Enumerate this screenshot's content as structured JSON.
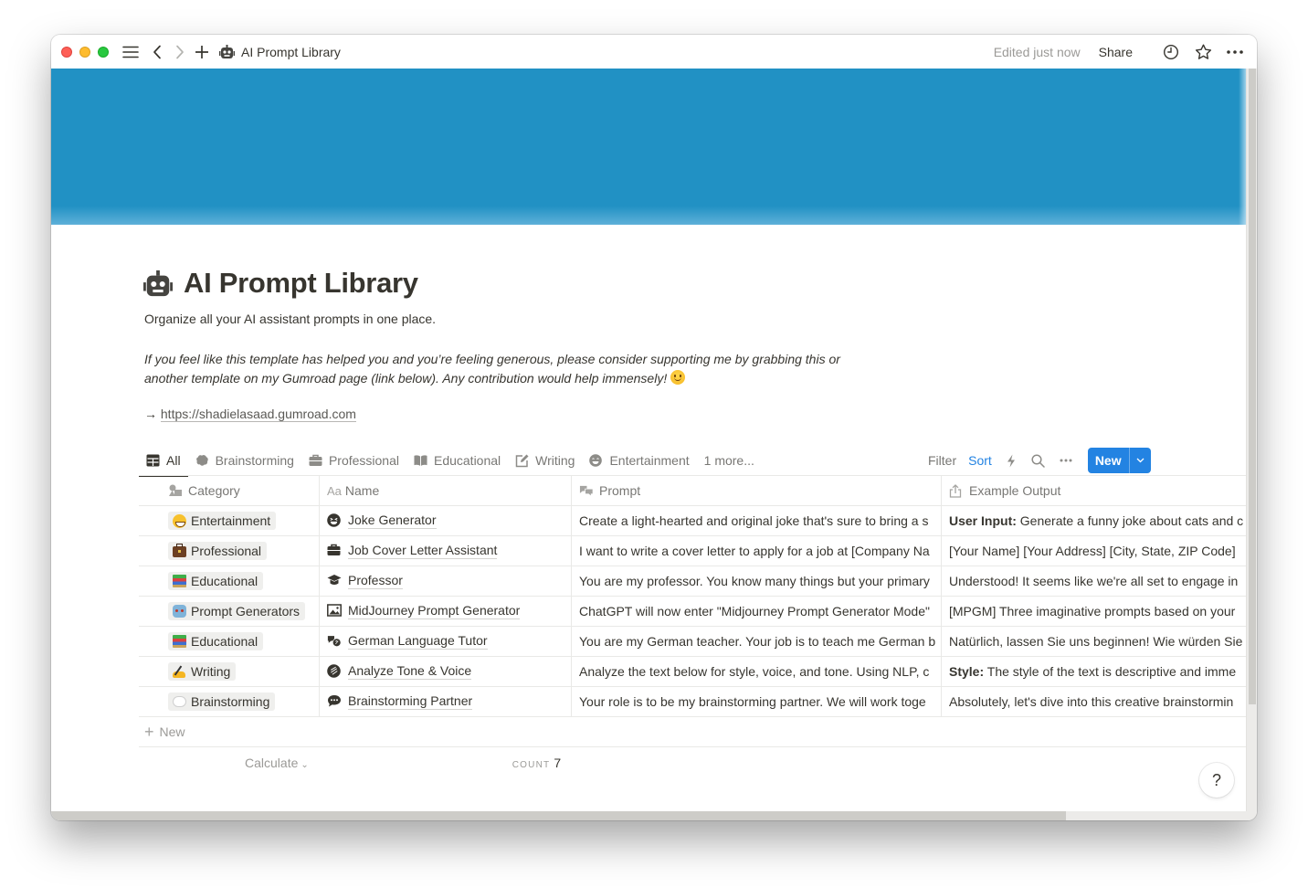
{
  "window": {
    "title": "AI Prompt Library",
    "edited_status": "Edited just now",
    "share_label": "Share"
  },
  "page": {
    "title": "AI Prompt Library",
    "description": "Organize all your AI assistant prompts in one place.",
    "support_text": "If you feel like this template has helped you and you’re feeling generous, please consider supporting me by grabbing this or another template on my Gumroad page (link below). Any contribution would help immensely!",
    "link_arrow": "→",
    "link_text": "https://shadielasaad.gumroad.com",
    "cover_color": "#2191c4"
  },
  "views": {
    "tabs": [
      {
        "label": "All",
        "icon": "table-icon",
        "active": true
      },
      {
        "label": "Brainstorming",
        "icon": "brain-icon",
        "active": false
      },
      {
        "label": "Professional",
        "icon": "briefcase-icon",
        "active": false
      },
      {
        "label": "Educational",
        "icon": "book-icon",
        "active": false
      },
      {
        "label": "Writing",
        "icon": "edit-icon",
        "active": false
      },
      {
        "label": "Entertainment",
        "icon": "grin-icon",
        "active": false
      }
    ],
    "more_label": "1 more...",
    "filter_label": "Filter",
    "sort_label": "Sort",
    "new_label": "New",
    "accent_color": "#2383e2"
  },
  "table": {
    "columns": [
      {
        "label": "Category",
        "icon": "multi-select-icon"
      },
      {
        "label": "Name",
        "icon": "text-title-icon",
        "icon_text": "Aa"
      },
      {
        "label": "Prompt",
        "icon": "comments-icon"
      },
      {
        "label": "Example Output",
        "icon": "share-icon"
      }
    ],
    "rows": [
      {
        "category": "Entertainment",
        "category_emoji": "grinning-face",
        "name": "Joke Generator",
        "name_icon": "grin-squint-icon",
        "prompt": "Create a light-hearted and original joke that's sure to bring a s",
        "output_bold": "User Input:",
        "output": " Generate a funny joke about cats and c"
      },
      {
        "category": "Professional",
        "category_emoji": "briefcase",
        "name": "Job Cover Letter Assistant",
        "name_icon": "briefcase-icon",
        "prompt": "I want to write a cover letter to apply for a job at [Company Na",
        "output_bold": "",
        "output": "[Your Name] [Your Address] [City, State, ZIP Code]"
      },
      {
        "category": "Educational",
        "category_emoji": "books",
        "name": "Professor",
        "name_icon": "graduation-cap-icon",
        "prompt": "You are my professor. You know many things but your primary",
        "output_bold": "",
        "output": "Understood! It seems like we're all set to engage in"
      },
      {
        "category": "Prompt Generators",
        "category_emoji": "robot",
        "name": "MidJourney Prompt Generator",
        "name_icon": "image-icon",
        "prompt": "ChatGPT will now enter \"Midjourney Prompt Generator Mode\"",
        "output_bold": "",
        "output": "[MPGM] Three imaginative prompts based on your"
      },
      {
        "category": "Educational",
        "category_emoji": "books",
        "name": "German Language Tutor",
        "name_icon": "language-icon",
        "prompt": "You are my German teacher. Your job is to teach me German b",
        "output_bold": "",
        "output": "Natürlich, lassen Sie uns beginnen! Wie würden Sie"
      },
      {
        "category": "Writing",
        "category_emoji": "writing-hand",
        "name": "Analyze Tone & Voice",
        "name_icon": "palette-icon",
        "prompt": "Analyze the text below for style, voice, and tone. Using NLP, c",
        "output_bold": "Style:",
        "output": " The style of the text is descriptive and imme"
      },
      {
        "category": "Brainstorming",
        "category_emoji": "thought-balloon",
        "name": "Brainstorming Partner",
        "name_icon": "comment-dots-icon",
        "prompt": "Your role is to be my brainstorming partner. We will work toge",
        "output_bold": "",
        "output": "Absolutely, let's dive into this creative brainstormin"
      }
    ],
    "add_row_label": "New",
    "calculate_label": "Calculate",
    "count_label": "COUNT",
    "count_value": "7"
  },
  "help_label": "?",
  "scroll": {
    "vertical_thumb_fraction": 0.86,
    "horizontal_thumb_fraction": 0.84
  }
}
